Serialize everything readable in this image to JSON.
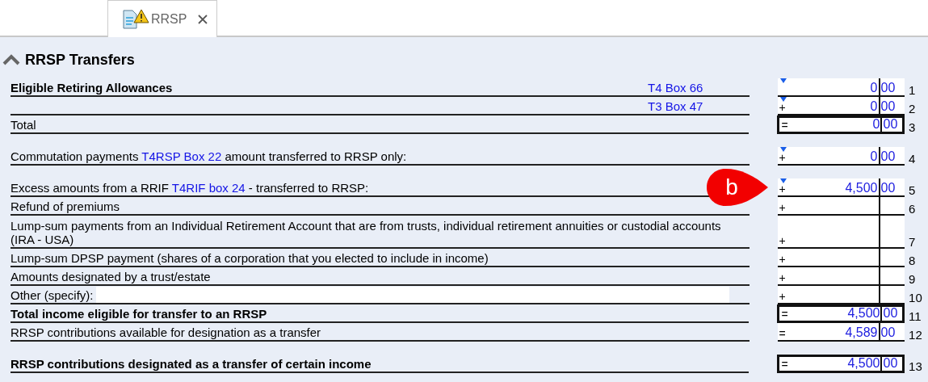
{
  "tabs": [
    {
      "label": "RRSP",
      "selected": true,
      "warning": true
    }
  ],
  "section": {
    "title": "RRSP Transfers",
    "expanded": true
  },
  "groups": [
    {
      "rows": [
        {
          "kind": "amount",
          "bold": true,
          "parts": [
            {
              "kind": "text",
              "text": "Eligible Retiring Allowances"
            }
          ],
          "side_link": "T4 Box 66",
          "operator": "",
          "marker": true,
          "boxed": false,
          "dollars": "0",
          "cents": "00",
          "line": "1"
        },
        {
          "kind": "amount",
          "parts": [],
          "side_link": "T3 Box 47",
          "operator": "+",
          "marker": true,
          "boxed": false,
          "dollars": "0",
          "cents": "00",
          "line": "2"
        },
        {
          "kind": "amount",
          "bold": false,
          "parts": [
            {
              "kind": "text",
              "text": "Total"
            }
          ],
          "operator": "=",
          "marker": false,
          "boxed": true,
          "dollars": "0",
          "cents": "00",
          "line": "3"
        }
      ]
    },
    {
      "rows": [
        {
          "kind": "amount",
          "bold": false,
          "parts": [
            {
              "kind": "text",
              "text": "Commutation payments "
            },
            {
              "kind": "link",
              "text": "T4RSP Box 22"
            },
            {
              "kind": "text",
              "text": " amount transferred to RRSP only:"
            }
          ],
          "operator": "+",
          "marker": true,
          "boxed": false,
          "dollars": "0",
          "cents": "00",
          "line": "4"
        }
      ]
    },
    {
      "rows": [
        {
          "kind": "amount",
          "bold": false,
          "parts": [
            {
              "kind": "text",
              "text": "Excess amounts from a RRIF "
            },
            {
              "kind": "link",
              "text": "T4RIF box 24"
            },
            {
              "kind": "text",
              "text": " - transferred to RRSP:"
            }
          ],
          "operator": "+",
          "marker": true,
          "boxed": false,
          "dollars": "4,500",
          "cents": "00",
          "line": "5",
          "callout": "b"
        },
        {
          "kind": "amount",
          "bold": false,
          "parts": [
            {
              "kind": "text",
              "text": "Refund of premiums"
            }
          ],
          "operator": "+",
          "marker": false,
          "boxed": false,
          "line": "6"
        },
        {
          "kind": "amount",
          "bold": false,
          "parts": [
            {
              "kind": "text",
              "text": "Lump-sum payments from an Individual Retirement Account that are from trusts, individual retirement annuities or custodial accounts (IRA - USA)"
            }
          ],
          "operator": "+",
          "marker": false,
          "boxed": false,
          "line": "7"
        },
        {
          "kind": "amount",
          "bold": false,
          "parts": [
            {
              "kind": "text",
              "text": "Lump-sum DPSP payment (shares of a corporation that you elected to include in income)"
            }
          ],
          "operator": "+",
          "marker": false,
          "boxed": false,
          "line": "8"
        },
        {
          "kind": "amount",
          "bold": false,
          "parts": [
            {
              "kind": "text",
              "text": "Amounts designated by a trust/estate"
            }
          ],
          "operator": "+",
          "marker": false,
          "boxed": false,
          "line": "9"
        },
        {
          "kind": "specify",
          "bold": false,
          "parts": [
            {
              "kind": "text",
              "text": "Other (specify):"
            }
          ],
          "operator": "+",
          "marker": false,
          "boxed": false,
          "line": "10"
        },
        {
          "kind": "amount",
          "bold": true,
          "parts": [
            {
              "kind": "text",
              "text": "Total income eligible for transfer to an RRSP"
            }
          ],
          "operator": "=",
          "marker": false,
          "boxed": true,
          "dollars": "4,500",
          "cents": "00",
          "line": "11"
        },
        {
          "kind": "amount",
          "bold": false,
          "parts": [
            {
              "kind": "text",
              "text": "RRSP contributions available for designation as a transfer"
            }
          ],
          "operator": "=",
          "marker": false,
          "boxed": false,
          "dollars": "4,589",
          "cents": "00",
          "line": "12"
        }
      ]
    },
    {
      "rows": [
        {
          "kind": "amount",
          "bold": true,
          "parts": [
            {
              "kind": "text",
              "text": "RRSP contributions designated as a transfer of certain income"
            }
          ],
          "operator": "=",
          "marker": false,
          "boxed": true,
          "dollars": "4,500",
          "cents": "00",
          "line": "13"
        }
      ]
    }
  ]
}
